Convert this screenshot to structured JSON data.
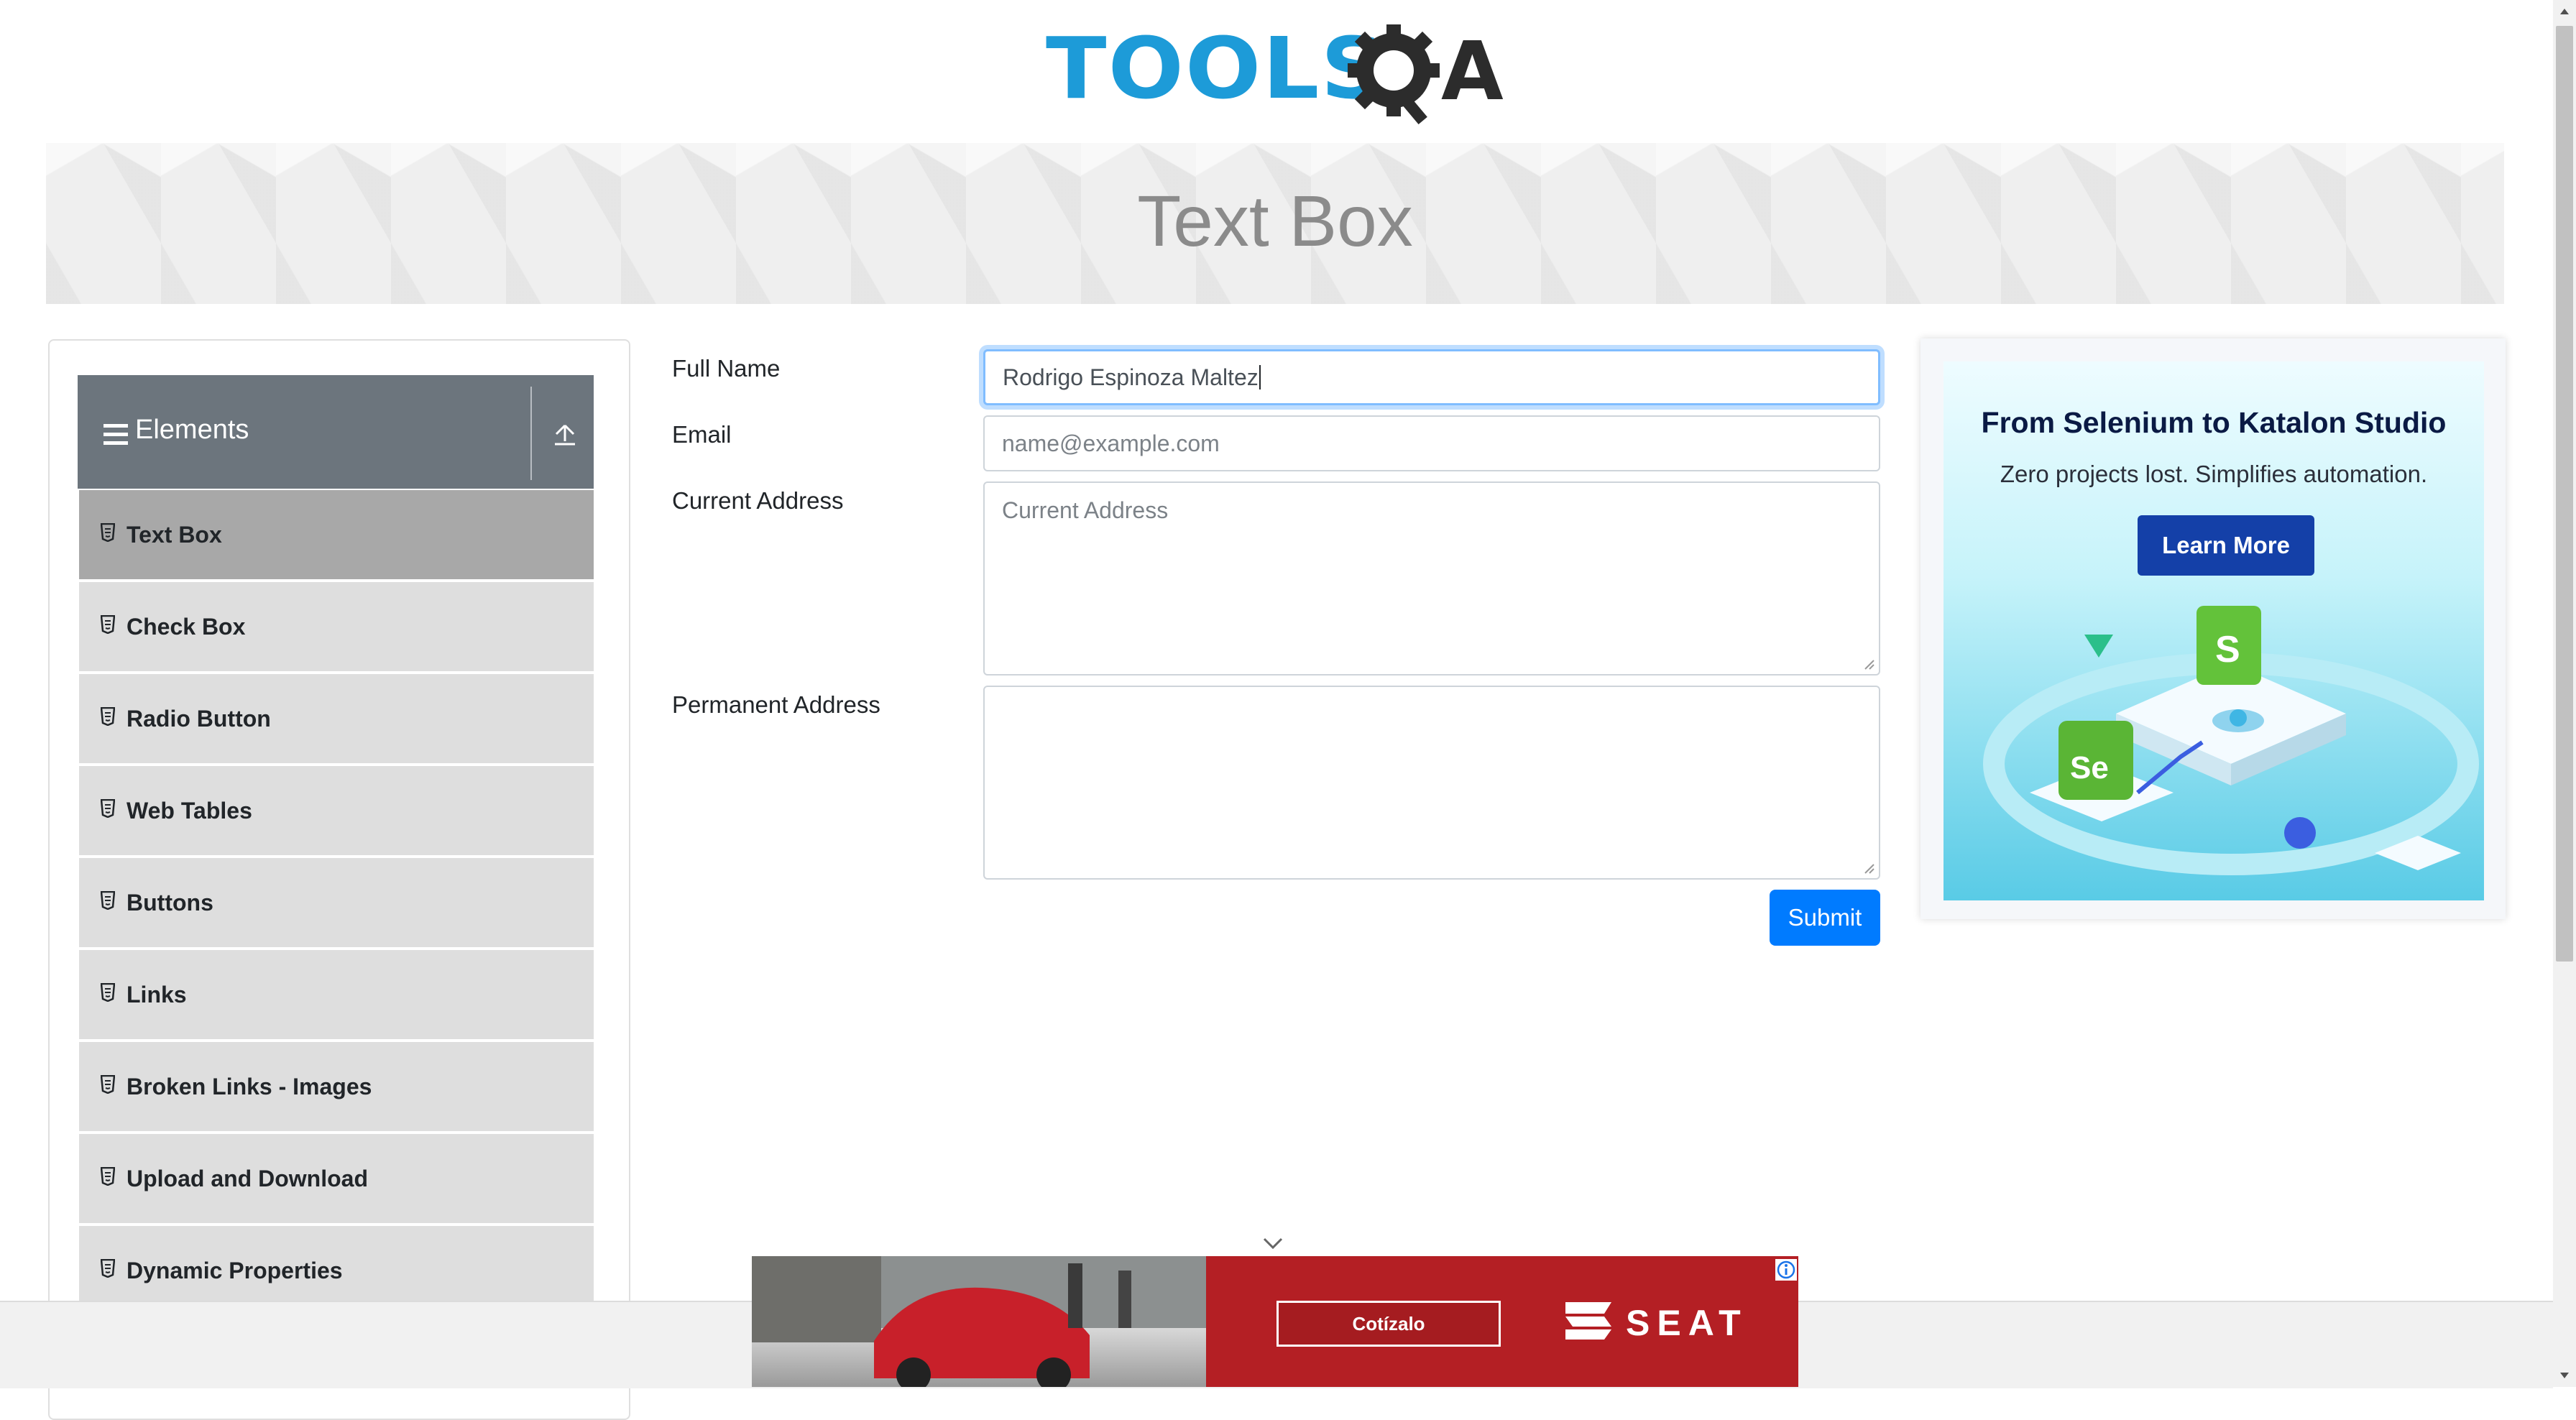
{
  "logo": {
    "text_tools": "TOOLS",
    "text_q": "Q",
    "text_a": "A"
  },
  "banner": {
    "title": "Text Box"
  },
  "sidebar": {
    "group_label": "Elements",
    "items": [
      {
        "label": "Text Box",
        "active": true
      },
      {
        "label": "Check Box"
      },
      {
        "label": "Radio Button"
      },
      {
        "label": "Web Tables"
      },
      {
        "label": "Buttons"
      },
      {
        "label": "Links"
      },
      {
        "label": "Broken Links - Images"
      },
      {
        "label": "Upload and Download"
      },
      {
        "label": "Dynamic Properties"
      }
    ]
  },
  "form": {
    "full_name_label": "Full Name",
    "full_name_value": "Rodrigo Espinoza Maltez",
    "email_label": "Email",
    "email_placeholder": "name@example.com",
    "current_address_label": "Current Address",
    "current_address_placeholder": "Current Address",
    "permanent_address_label": "Permanent Address",
    "submit_label": "Submit"
  },
  "ad": {
    "title": "From Selenium to Katalon Studio",
    "subtitle": "Zero projects lost. Simplifies automation.",
    "button": "Learn More"
  },
  "bottom_ad": {
    "cta": "Cotízalo",
    "brand": "SEAT"
  },
  "colors": {
    "primary": "#007bff",
    "sidebar_header": "#6c757d",
    "menu_item": "#dedede",
    "menu_item_active": "#a8a8a8",
    "logo_blue": "#1d9bd8",
    "ad_red": "#b41f24"
  }
}
